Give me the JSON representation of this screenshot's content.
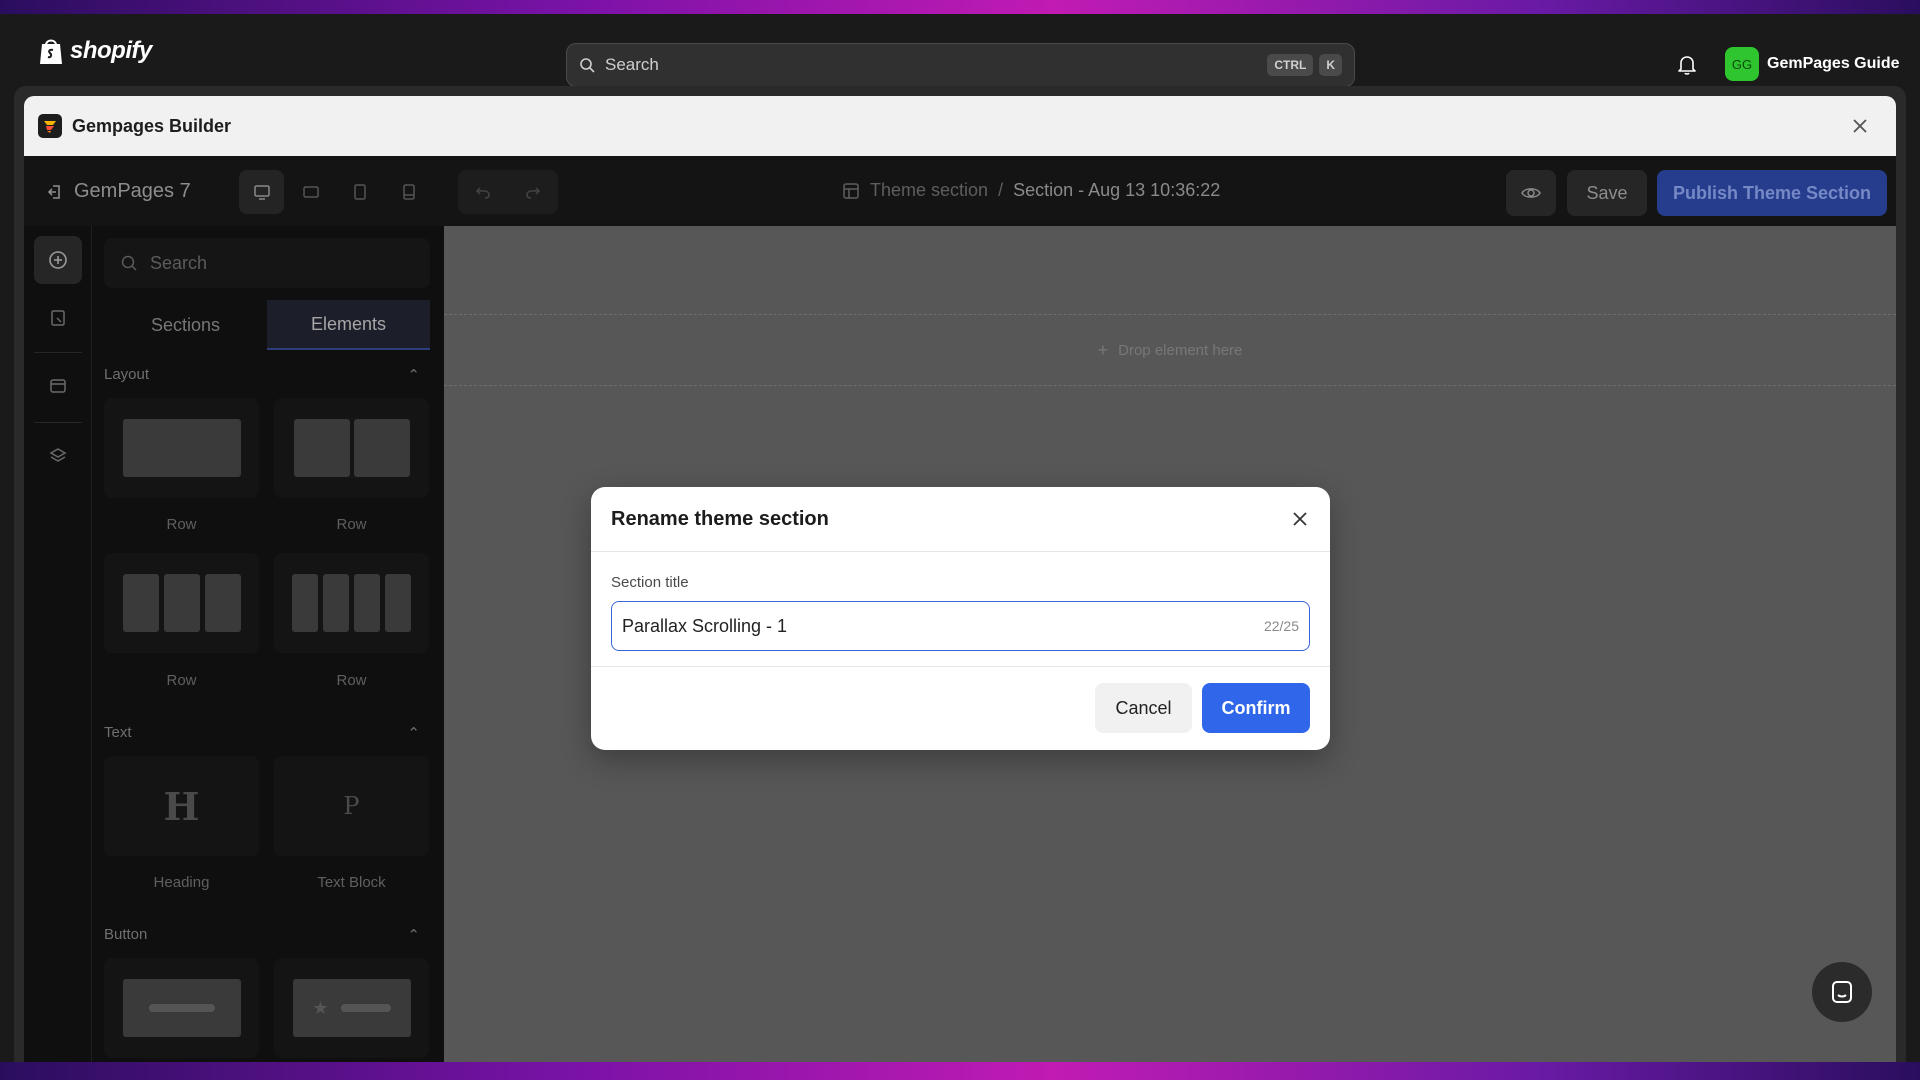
{
  "shopify": {
    "brand": "shopify",
    "search_placeholder": "Search",
    "shortcut_keys": [
      "CTRL",
      "K"
    ],
    "user_initials": "GG",
    "user_name": "GemPages Guide",
    "avatar_color": "#2ec52e"
  },
  "app": {
    "title": "Gempages Builder"
  },
  "builder": {
    "page_name": "GemPages 7",
    "breadcrumb": {
      "parent": "Theme section",
      "separator": "/",
      "current": "Section - Aug 13 10:36:22"
    },
    "save_label": "Save",
    "publish_label": "Publish Theme Section",
    "publish_color": "#253d8c"
  },
  "panel": {
    "search_placeholder": "Search",
    "tabs": [
      "Sections",
      "Elements"
    ],
    "active_tab": "Elements",
    "groups": {
      "layout": "Layout",
      "text": "Text",
      "button": "Button"
    },
    "layout_items": [
      "Row",
      "Row",
      "Row",
      "Row"
    ],
    "text_items": [
      "Heading",
      "Text Block"
    ],
    "heading_glyph": "H",
    "textblock_glyph": "P"
  },
  "canvas": {
    "drop_label": "Drop element here"
  },
  "dialog": {
    "title": "Rename theme section",
    "field_label": "Section title",
    "field_value": "Parallax Scrolling - 1",
    "counter": "22/25",
    "cancel_label": "Cancel",
    "confirm_label": "Confirm",
    "accent_color": "#2f66ea"
  }
}
